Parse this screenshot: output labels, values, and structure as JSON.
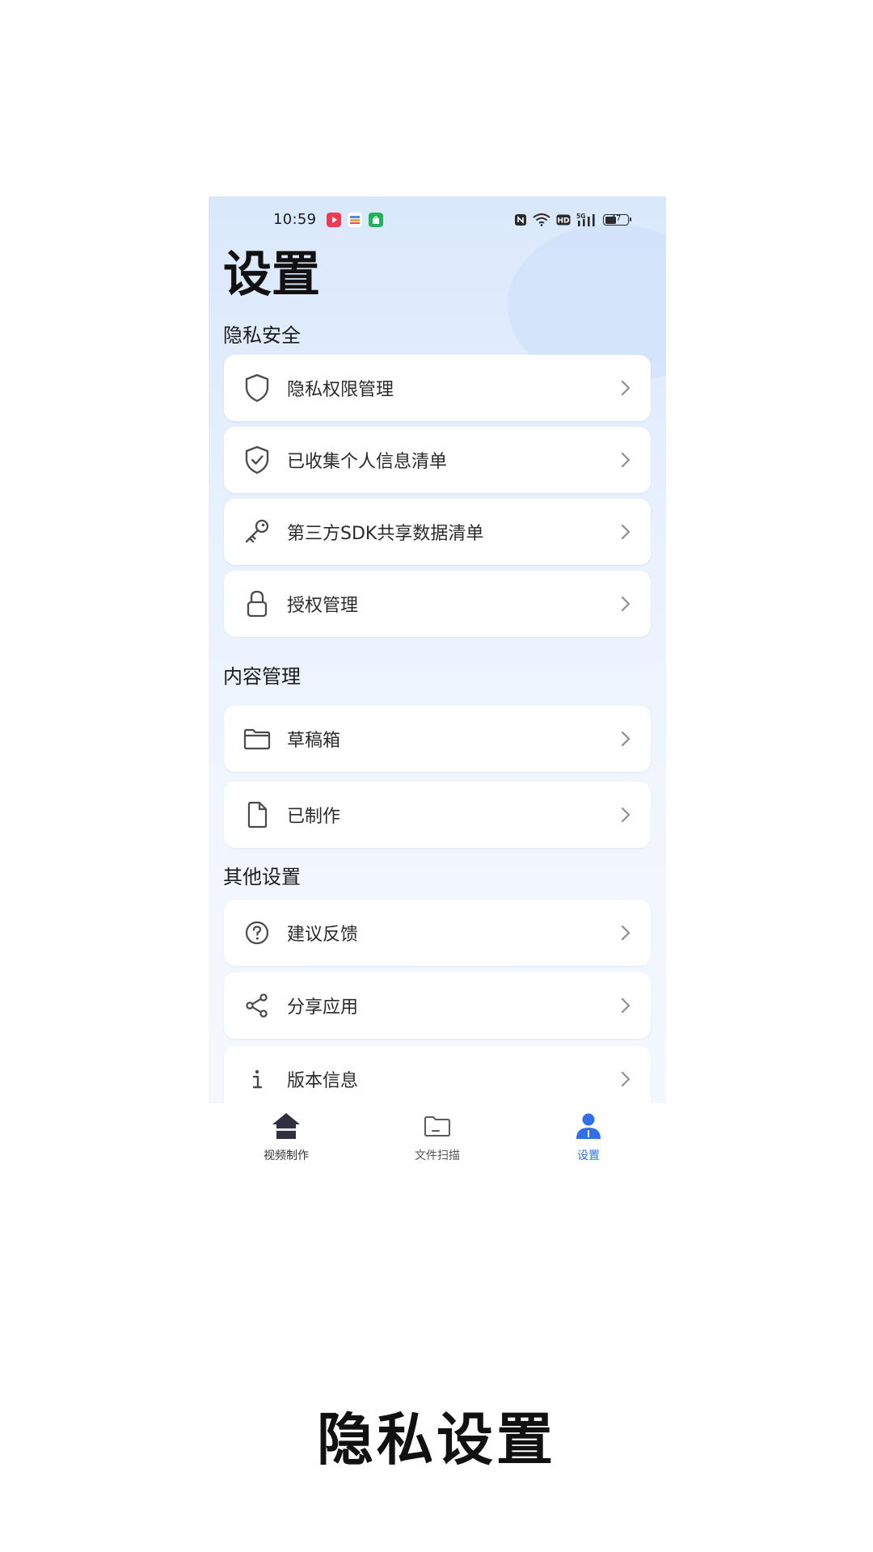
{
  "statusbar": {
    "time": "10:59",
    "battery": "47",
    "network": "5G",
    "hd_badge": "HD"
  },
  "page": {
    "title": "设置"
  },
  "sections": {
    "privacy": {
      "title": "隐私安全",
      "items": [
        {
          "label": "隐私权限管理",
          "icon": "shield-icon"
        },
        {
          "label": "已收集个人信息清单",
          "icon": "shield-check-icon"
        },
        {
          "label": "第三方SDK共享数据清单",
          "icon": "key-icon"
        },
        {
          "label": "授权管理",
          "icon": "lock-icon"
        }
      ]
    },
    "content": {
      "title": "内容管理",
      "items": [
        {
          "label": "草稿箱",
          "icon": "folder-icon"
        },
        {
          "label": "已制作",
          "icon": "file-icon"
        }
      ]
    },
    "other": {
      "title": "其他设置",
      "items": [
        {
          "label": "建议反馈",
          "icon": "question-icon"
        },
        {
          "label": "分享应用",
          "icon": "share-icon"
        },
        {
          "label": "版本信息",
          "icon": "info-icon"
        }
      ]
    }
  },
  "tabbar": {
    "tabs": [
      {
        "label": "视频制作",
        "icon": "home-icon",
        "active": false
      },
      {
        "label": "文件扫描",
        "icon": "folder-icon",
        "active": false
      },
      {
        "label": "设置",
        "icon": "user-icon",
        "active": true
      }
    ],
    "active_color": "#2f6fe8",
    "inactive_color": "#333333"
  },
  "caption": "隐私设置"
}
